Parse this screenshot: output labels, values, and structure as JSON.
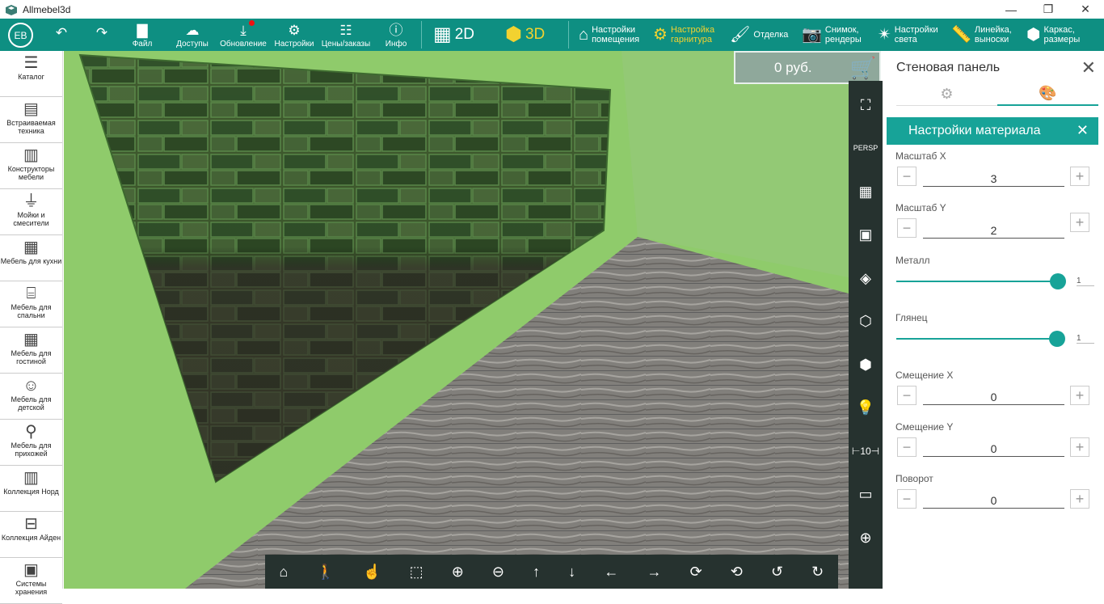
{
  "app": {
    "title": "Allmebel3d"
  },
  "toolbar": {
    "avatar": "EB",
    "file": "Файл",
    "access": "Доступы",
    "update": "Обновление",
    "settings": "Настройки",
    "prices": "Цены/заказы",
    "info": "Инфо",
    "view2d": "2D",
    "view3d": "3D",
    "room_settings": [
      "Настройки",
      "помещения"
    ],
    "set_settings": [
      "Настройка",
      "гарнитура"
    ],
    "finish": "Отделка",
    "snapshot": [
      "Снимок,",
      "рендеры"
    ],
    "light": [
      "Настройки",
      "света"
    ],
    "ruler": [
      "Линейка,",
      "выноски"
    ],
    "frame": [
      "Каркас,",
      "размеры"
    ]
  },
  "sidebar": {
    "items": [
      {
        "label": "Каталог",
        "icon": "menu-icon"
      },
      {
        "label": "Встраиваемая техника",
        "icon": "oven-icon"
      },
      {
        "label": "Конструкторы мебели",
        "icon": "cabinet-icon"
      },
      {
        "label": "Мойки и смесители",
        "icon": "sink-icon"
      },
      {
        "label": "Мебель для кухни",
        "icon": "kitchen-icon"
      },
      {
        "label": "Мебель для спальни",
        "icon": "bed-icon"
      },
      {
        "label": "Мебель для гостиной",
        "icon": "shelf-icon"
      },
      {
        "label": "Мебель для детской",
        "icon": "teddy-icon"
      },
      {
        "label": "Мебель для прихожей",
        "icon": "hanger-icon"
      },
      {
        "label": "Коллекция Норд",
        "icon": "wardrobe-icon"
      },
      {
        "label": "Коллекция Айден",
        "icon": "desk-icon"
      },
      {
        "label": "Системы хранения",
        "icon": "storage-icon"
      }
    ]
  },
  "price": "0 руб.",
  "view": {
    "persp": "PERSP"
  },
  "panel": {
    "title": "Стеновая панель",
    "material_title": "Настройки материала",
    "scale_x": {
      "label": "Масштаб X",
      "value": "3"
    },
    "scale_y": {
      "label": "Масштаб Y",
      "value": "2"
    },
    "metal": {
      "label": "Металл",
      "value": "1",
      "level": 1
    },
    "gloss": {
      "label": "Глянец",
      "value": "1",
      "level": 1
    },
    "offset_x": {
      "label": "Смещение X",
      "value": "0"
    },
    "offset_y": {
      "label": "Смещение Y",
      "value": "0"
    },
    "rotation": {
      "label": "Поворот",
      "value": "0"
    }
  },
  "colors": {
    "teal": "#0e8f82",
    "accent": "#17a398",
    "wall": "#8cc96b",
    "dark": "#26322f"
  }
}
